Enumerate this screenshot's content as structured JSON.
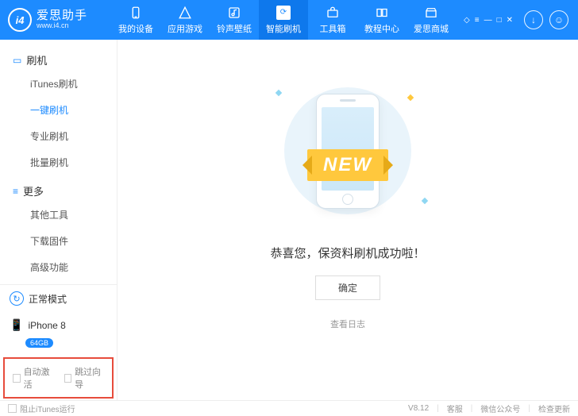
{
  "logo": {
    "mark": "i4",
    "title": "爱思助手",
    "sub": "www.i4.cn"
  },
  "nav": [
    {
      "icon": "phone",
      "label": "我的设备"
    },
    {
      "icon": "apps",
      "label": "应用游戏"
    },
    {
      "icon": "ringtone",
      "label": "铃声壁纸"
    },
    {
      "icon": "flash",
      "label": "智能刷机"
    },
    {
      "icon": "toolbox",
      "label": "工具箱"
    },
    {
      "icon": "tutorial",
      "label": "教程中心"
    },
    {
      "icon": "store",
      "label": "爱思商城"
    }
  ],
  "sidebar": {
    "group1": {
      "title": "刷机",
      "items": [
        "iTunes刷机",
        "一键刷机",
        "专业刷机",
        "批量刷机"
      ],
      "active": 1
    },
    "group2": {
      "title": "更多",
      "items": [
        "其他工具",
        "下载固件",
        "高级功能"
      ]
    }
  },
  "mode": "正常模式",
  "device": {
    "name": "iPhone 8",
    "storage": "64GB"
  },
  "options": {
    "auto_activate": "自动激活",
    "skip_wizard": "跳过向导"
  },
  "main": {
    "ribbon": "NEW",
    "message": "恭喜您，保资料刷机成功啦！",
    "ok": "确定",
    "log": "查看日志"
  },
  "footer": {
    "block_itunes": "阻止iTunes运行",
    "version": "V8.12",
    "support": "客服",
    "wechat": "微信公众号",
    "update": "检查更新"
  }
}
